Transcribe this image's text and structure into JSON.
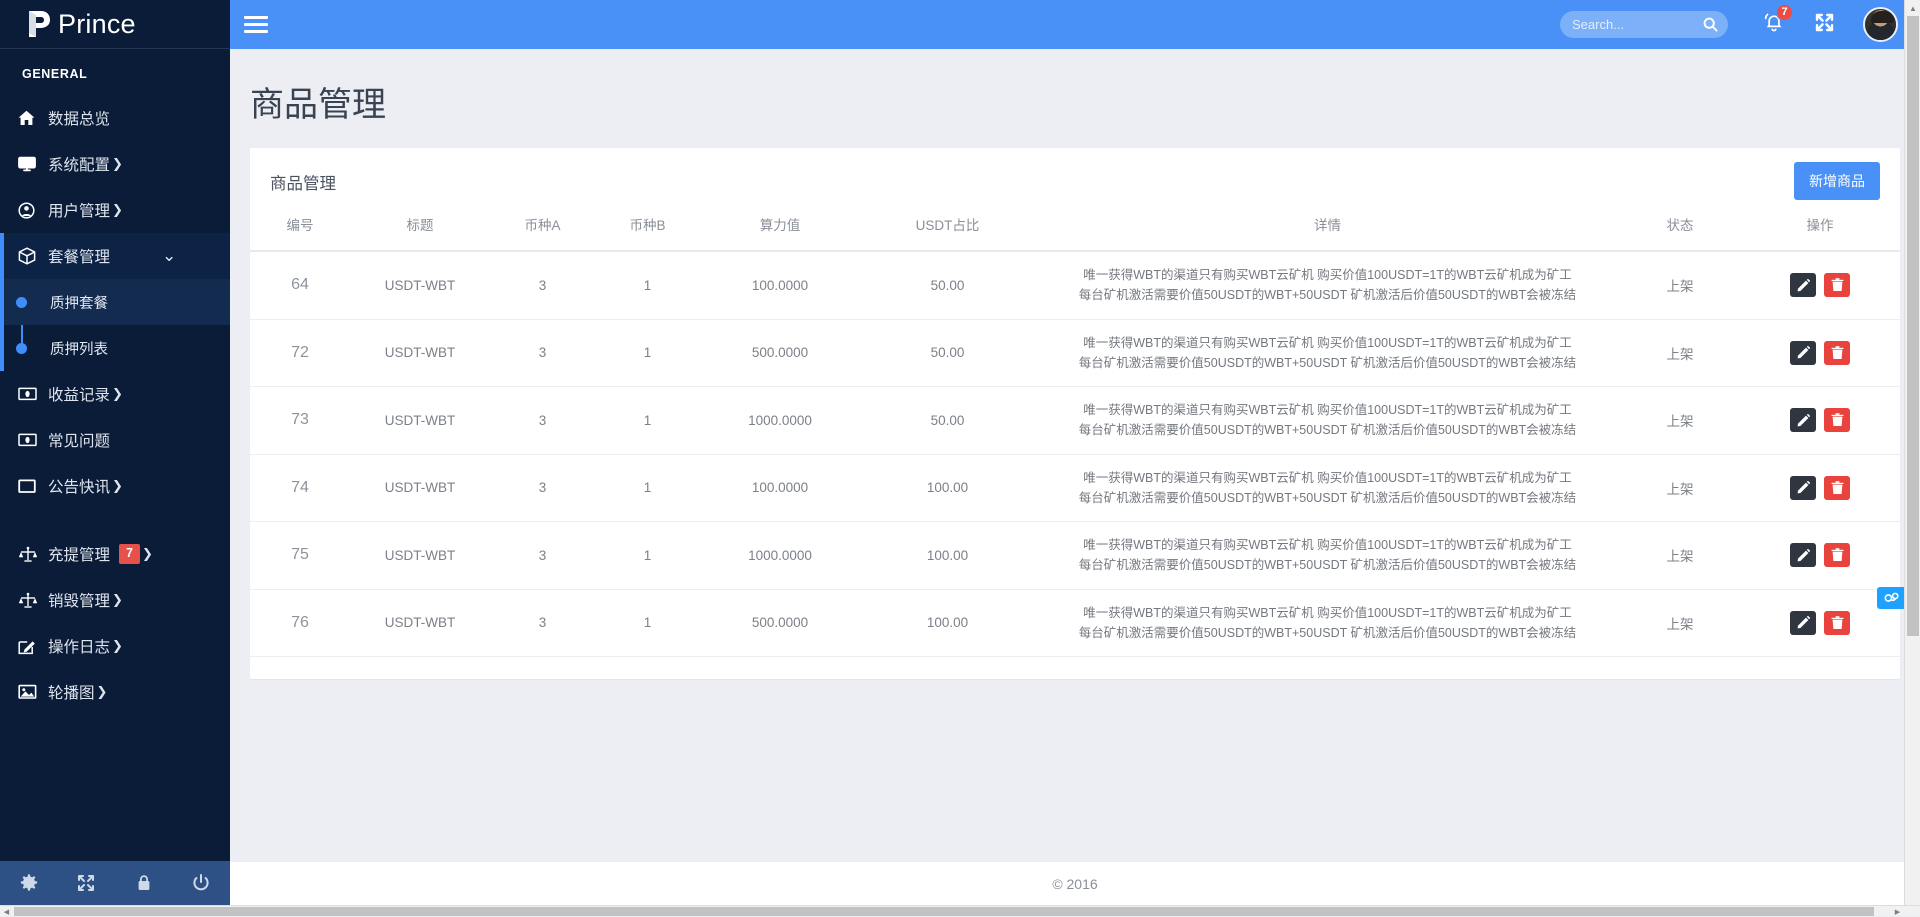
{
  "brand": {
    "name": "Prince",
    "logo_icon": "p-logo-icon"
  },
  "topbar": {
    "hamburger_icon": "hamburger-icon",
    "search": {
      "placeholder": "Search...",
      "value": "",
      "icon": "search-icon"
    },
    "notifications": {
      "icon": "bell-icon",
      "count": "7"
    },
    "fullscreen_icon": "expand-arrows-icon",
    "avatar_icon": "user-avatar",
    "background_color": "#4a91f7"
  },
  "sidebar": {
    "section_title": "GENERAL",
    "background_color": "#0b1c38",
    "accent_color": "#3f8efc",
    "items": [
      {
        "label": "数据总览",
        "icon": "home-icon",
        "caret": "",
        "badge": "",
        "active": false
      },
      {
        "label": "系统配置",
        "icon": "monitor-icon",
        "caret": "❯",
        "badge": "",
        "active": false
      },
      {
        "label": "用户管理",
        "icon": "user-circle-icon",
        "caret": "❯",
        "badge": "",
        "active": false
      },
      {
        "label": "套餐管理",
        "icon": "box-icon",
        "caret": "⌄",
        "badge": "",
        "active": true
      },
      {
        "label": "收益记录",
        "icon": "money-icon",
        "caret": "❯",
        "badge": "",
        "active": false
      },
      {
        "label": "常见问题",
        "icon": "money-icon",
        "caret": "",
        "badge": "",
        "active": false
      },
      {
        "label": "公告快讯",
        "icon": "window-icon",
        "caret": "❯",
        "badge": "",
        "active": false
      },
      {
        "label": "充提管理",
        "icon": "scales-icon",
        "caret": "❯",
        "badge": "7",
        "active": false
      },
      {
        "label": "销毁管理",
        "icon": "scales-icon",
        "caret": "❯",
        "badge": "",
        "active": false
      },
      {
        "label": "操作日志",
        "icon": "edit-square-icon",
        "caret": "❯",
        "badge": "",
        "active": false
      },
      {
        "label": "轮播图",
        "icon": "image-icon",
        "caret": "❯",
        "badge": "",
        "active": false
      }
    ],
    "submenu": [
      {
        "label": "质押套餐",
        "active": true
      },
      {
        "label": "质押列表",
        "active": false
      }
    ],
    "bottom_icons": [
      "gear-icon",
      "expand-arrows-icon",
      "lock-icon",
      "power-icon"
    ]
  },
  "main": {
    "page_title": "商品管理",
    "card_title": "商品管理",
    "add_button": "新增商品",
    "table": {
      "headers": [
        "编号",
        "标题",
        "币种A",
        "币种B",
        "算力值",
        "USDT占比",
        "详情",
        "状态",
        "操作"
      ],
      "detail_line1": "唯一获得WBT的渠道只有购买WBT云矿机 购买价值100USDT=1T的WBT云矿机成为矿工",
      "detail_line2": "每台矿机激活需要价值50USDT的WBT+50USDT 矿机激活后价值50USDT的WBT会被冻结",
      "rows": [
        {
          "id": "64",
          "title": "USDT-WBT",
          "coin_a": "3",
          "coin_b": "1",
          "hashrate": "100.0000",
          "usdt_ratio": "50.00",
          "status": "上架"
        },
        {
          "id": "72",
          "title": "USDT-WBT",
          "coin_a": "3",
          "coin_b": "1",
          "hashrate": "500.0000",
          "usdt_ratio": "50.00",
          "status": "上架"
        },
        {
          "id": "73",
          "title": "USDT-WBT",
          "coin_a": "3",
          "coin_b": "1",
          "hashrate": "1000.0000",
          "usdt_ratio": "50.00",
          "status": "上架"
        },
        {
          "id": "74",
          "title": "USDT-WBT",
          "coin_a": "3",
          "coin_b": "1",
          "hashrate": "100.0000",
          "usdt_ratio": "100.00",
          "status": "上架"
        },
        {
          "id": "75",
          "title": "USDT-WBT",
          "coin_a": "3",
          "coin_b": "1",
          "hashrate": "1000.0000",
          "usdt_ratio": "100.00",
          "status": "上架"
        },
        {
          "id": "76",
          "title": "USDT-WBT",
          "coin_a": "3",
          "coin_b": "1",
          "hashrate": "500.0000",
          "usdt_ratio": "100.00",
          "status": "上架"
        }
      ],
      "row_actions": {
        "edit_icon": "pencil-icon",
        "delete_icon": "trash-icon"
      }
    }
  },
  "footer": {
    "copyright": "© 2016"
  },
  "float_widget": {
    "icon": "chat-bubble-icon",
    "color": "#1fa2ff"
  }
}
